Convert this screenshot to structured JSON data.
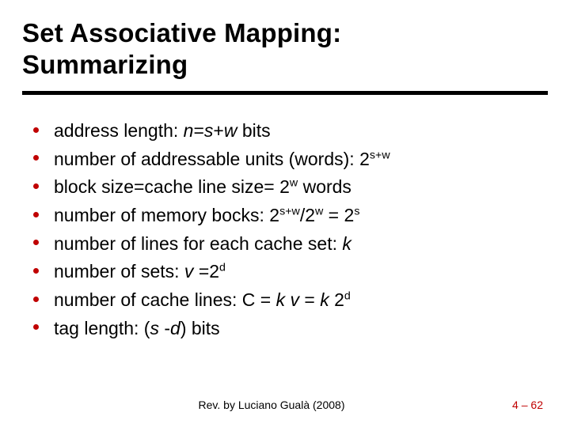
{
  "title_line1": "Set Associative Mapping:",
  "title_line2": "Summarizing",
  "bullets": {
    "b0": {
      "t0": "address length: ",
      "var_n": "n",
      "t1": "=",
      "var_s": "s",
      "t2": "+",
      "var_w": "w",
      "t3": " bits"
    },
    "b1": {
      "t0": "number of addressable units (words): 2",
      "sup": "s+w"
    },
    "b2": {
      "t0": "block size=cache line size= 2",
      "sup_w": "w",
      "t1": " words"
    },
    "b3": {
      "t0": "number of memory bocks: 2",
      "sup1": "s+w",
      "t1": "/2",
      "sup2": "w",
      "t2": " = 2",
      "sup3": "s"
    },
    "b4": {
      "t0": "number of lines for each cache set: ",
      "var_k": "k"
    },
    "b5": {
      "t0": "number of sets: ",
      "var_v": "v ",
      "t1": "=2",
      "sup_d": "d"
    },
    "b6": {
      "t0": "number of cache lines: C = ",
      "var_k": "k ",
      "var_v": "v ",
      "t1": "= ",
      "var_k2": "k ",
      "t2": "2",
      "sup_d": "d"
    },
    "b7": {
      "t0": "tag length: (",
      "var_s": "s ",
      "t1": "-",
      "var_d": "d",
      "t2": ") bits"
    }
  },
  "footer": {
    "center": "Rev. by Luciano Gualà (2008)",
    "chapter": "4",
    "dash": " – ",
    "page": "62"
  }
}
